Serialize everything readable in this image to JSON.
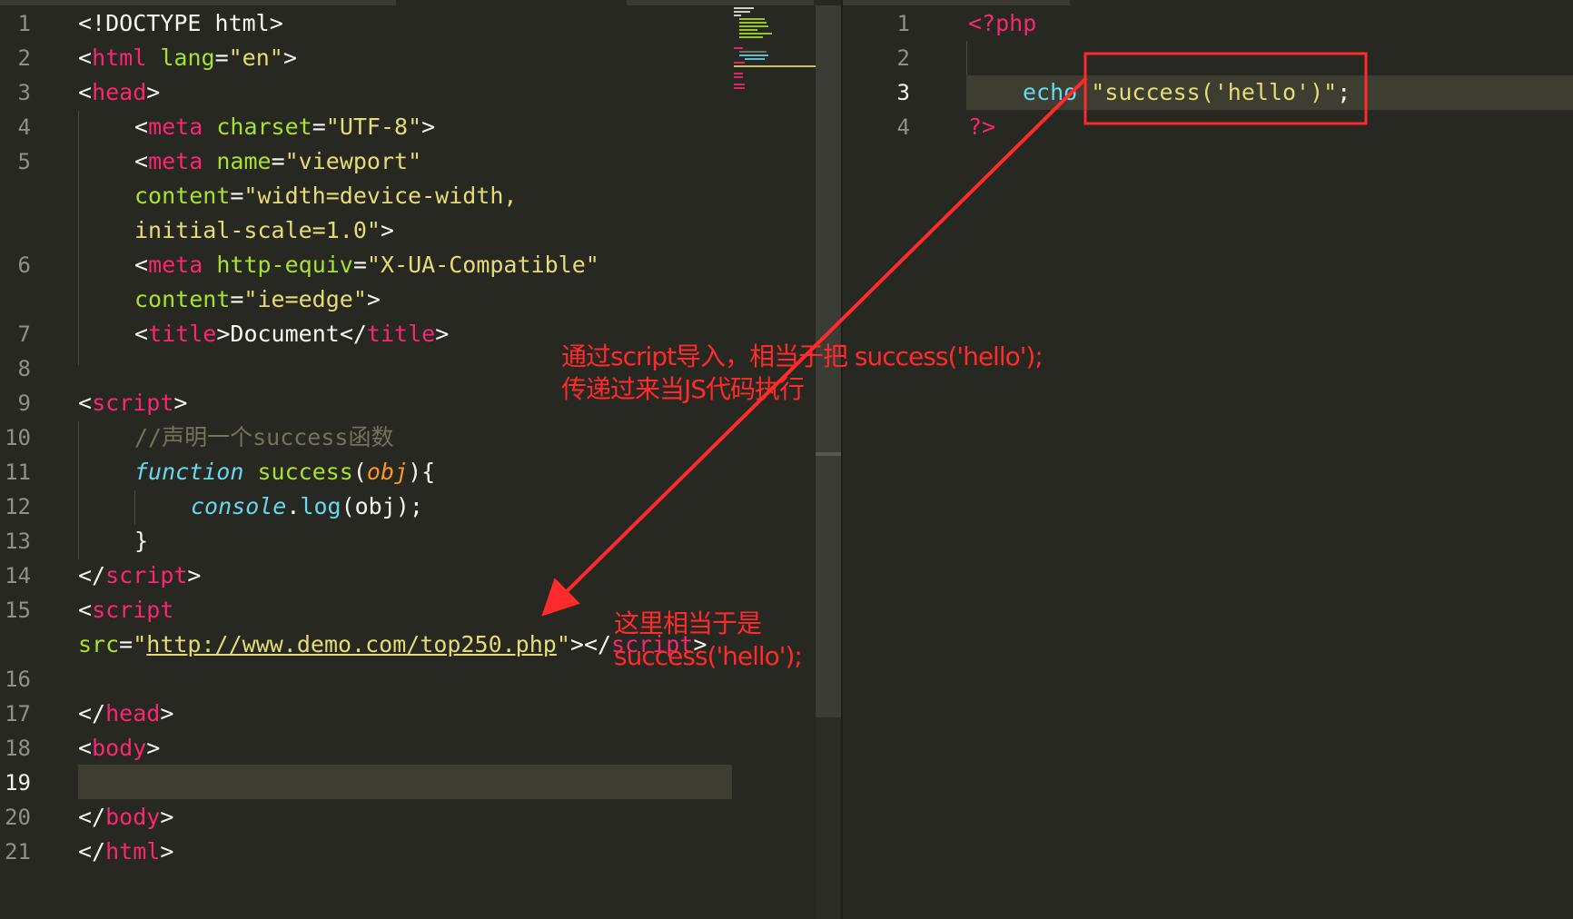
{
  "left_editor": {
    "line_numbers": [
      "1",
      "2",
      "3",
      "4",
      "5",
      "6",
      "7",
      "8",
      "9",
      "10",
      "11",
      "12",
      "13",
      "14",
      "15",
      "16",
      "17",
      "18",
      "19",
      "20",
      "21"
    ],
    "lines": {
      "l1": "<!DOCTYPE html>",
      "l2_open": "<",
      "l2_tag": "html",
      "l2_attr": "lang",
      "l2_eq": "=",
      "l2_val": "\"en\"",
      "l2_close": ">",
      "l3_open": "<",
      "l3_tag": "head",
      "l3_close": ">",
      "l4_open": "<",
      "l4_tag": "meta",
      "l4_attr": "charset",
      "l4_eq": "=",
      "l4_val": "\"UTF-8\"",
      "l4_close": ">",
      "l5a_open": "<",
      "l5a_tag": "meta",
      "l5a_attr": "name",
      "l5a_eq": "=",
      "l5a_val": "\"viewport\"",
      "l5b_attr": "content",
      "l5b_eq": "=",
      "l5b_val": "\"width=device-width,",
      "l5c_val": "initial-scale=1.0\"",
      "l5c_close": ">",
      "l6a_open": "<",
      "l6a_tag": "meta",
      "l6a_attr": "http-equiv",
      "l6a_eq": "=",
      "l6a_val": "\"X-UA-Compatible\"",
      "l6b_attr": "content",
      "l6b_eq": "=",
      "l6b_val": "\"ie=edge\"",
      "l6b_close": ">",
      "l7_open": "<",
      "l7_tag": "title",
      "l7_gt": ">",
      "l7_text": "Document",
      "l7_lt": "</",
      "l7_tag2": "title",
      "l7_close": ">",
      "l9_open": "<",
      "l9_tag": "script",
      "l9_close": ">",
      "l10_comment": "//声明一个success函数",
      "l11_kw": "function",
      "l11_name": "success",
      "l11_paren": "(",
      "l11_param": "obj",
      "l11_rest": "){",
      "l12_obj": "console",
      "l12_dot": ".",
      "l12_method": "log",
      "l12_rest": "(obj);",
      "l13": "}",
      "l14_open": "</",
      "l14_tag": "script",
      "l14_close": ">",
      "l15a_open": "<",
      "l15a_tag": "script",
      "l15b_attr": "src",
      "l15b_eq": "=",
      "l15b_q1": "\"",
      "l15b_url": "http://www.demo.com/top250.php",
      "l15b_q2": "\"",
      "l15b_rest": "></",
      "l15b_tag": "script",
      "l15b_close": ">",
      "l17_open": "</",
      "l17_tag": "head",
      "l17_close": ">",
      "l18_open": "<",
      "l18_tag": "body",
      "l18_close": ">",
      "l20_open": "</",
      "l20_tag": "body",
      "l20_close": ">",
      "l21_open": "</",
      "l21_tag": "html",
      "l21_close": ">"
    },
    "active_line": "19"
  },
  "right_editor": {
    "line_numbers": [
      "1",
      "2",
      "3",
      "4"
    ],
    "lines": {
      "r1": "<?php",
      "r3_kw": "echo",
      "r3_str": "\"success('hello')\"",
      "r3_semi": ";",
      "r4": "?>"
    }
  },
  "annotations": {
    "note1_line1": "通过script导入，相当于把 success('hello');",
    "note1_line2": "传递过来当JS代码执行",
    "note2_line1": "这里相当于是",
    "note2_line2": "success('hello');"
  },
  "colors": {
    "background": "#272822",
    "annotation_red": "#ff2a2a",
    "keyword": "#f92672",
    "attribute": "#a6e22e",
    "string": "#e6db74",
    "builtin": "#66d9ef"
  }
}
